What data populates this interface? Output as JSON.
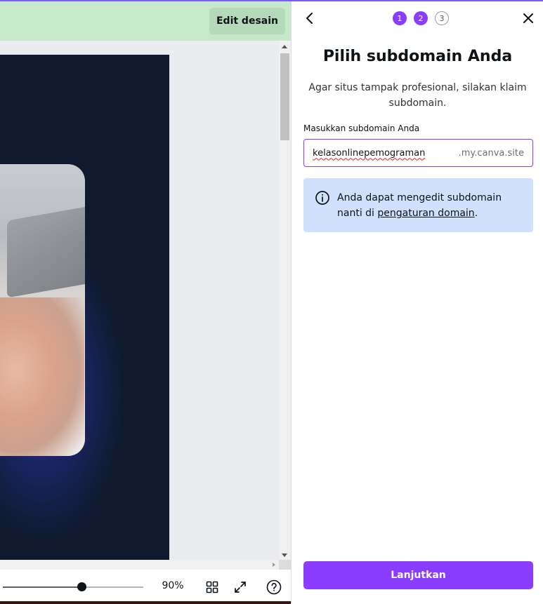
{
  "editor": {
    "edit_button_label": "Edit desain",
    "zoom_level": "90%",
    "zoom_fraction": 0.56
  },
  "panel": {
    "steps": [
      "1",
      "2",
      "3"
    ],
    "active_steps": 2,
    "title": "Pilih subdomain Anda",
    "subtitle": "Agar situs tampak profesional, silakan klaim subdomain.",
    "field_label": "Masukkan subdomain Anda",
    "subdomain_value": "kelasonlinepemograman",
    "domain_suffix": ".my.canva.site",
    "info_text": "Anda dapat mengedit subdomain nanti di ",
    "info_link": "pengaturan domain",
    "info_text_end": ".",
    "continue_label": "Lanjutkan"
  },
  "colors": {
    "accent": "#8b3dff",
    "banner": "#c6e9c9",
    "info_bg": "#cfe1fc"
  }
}
